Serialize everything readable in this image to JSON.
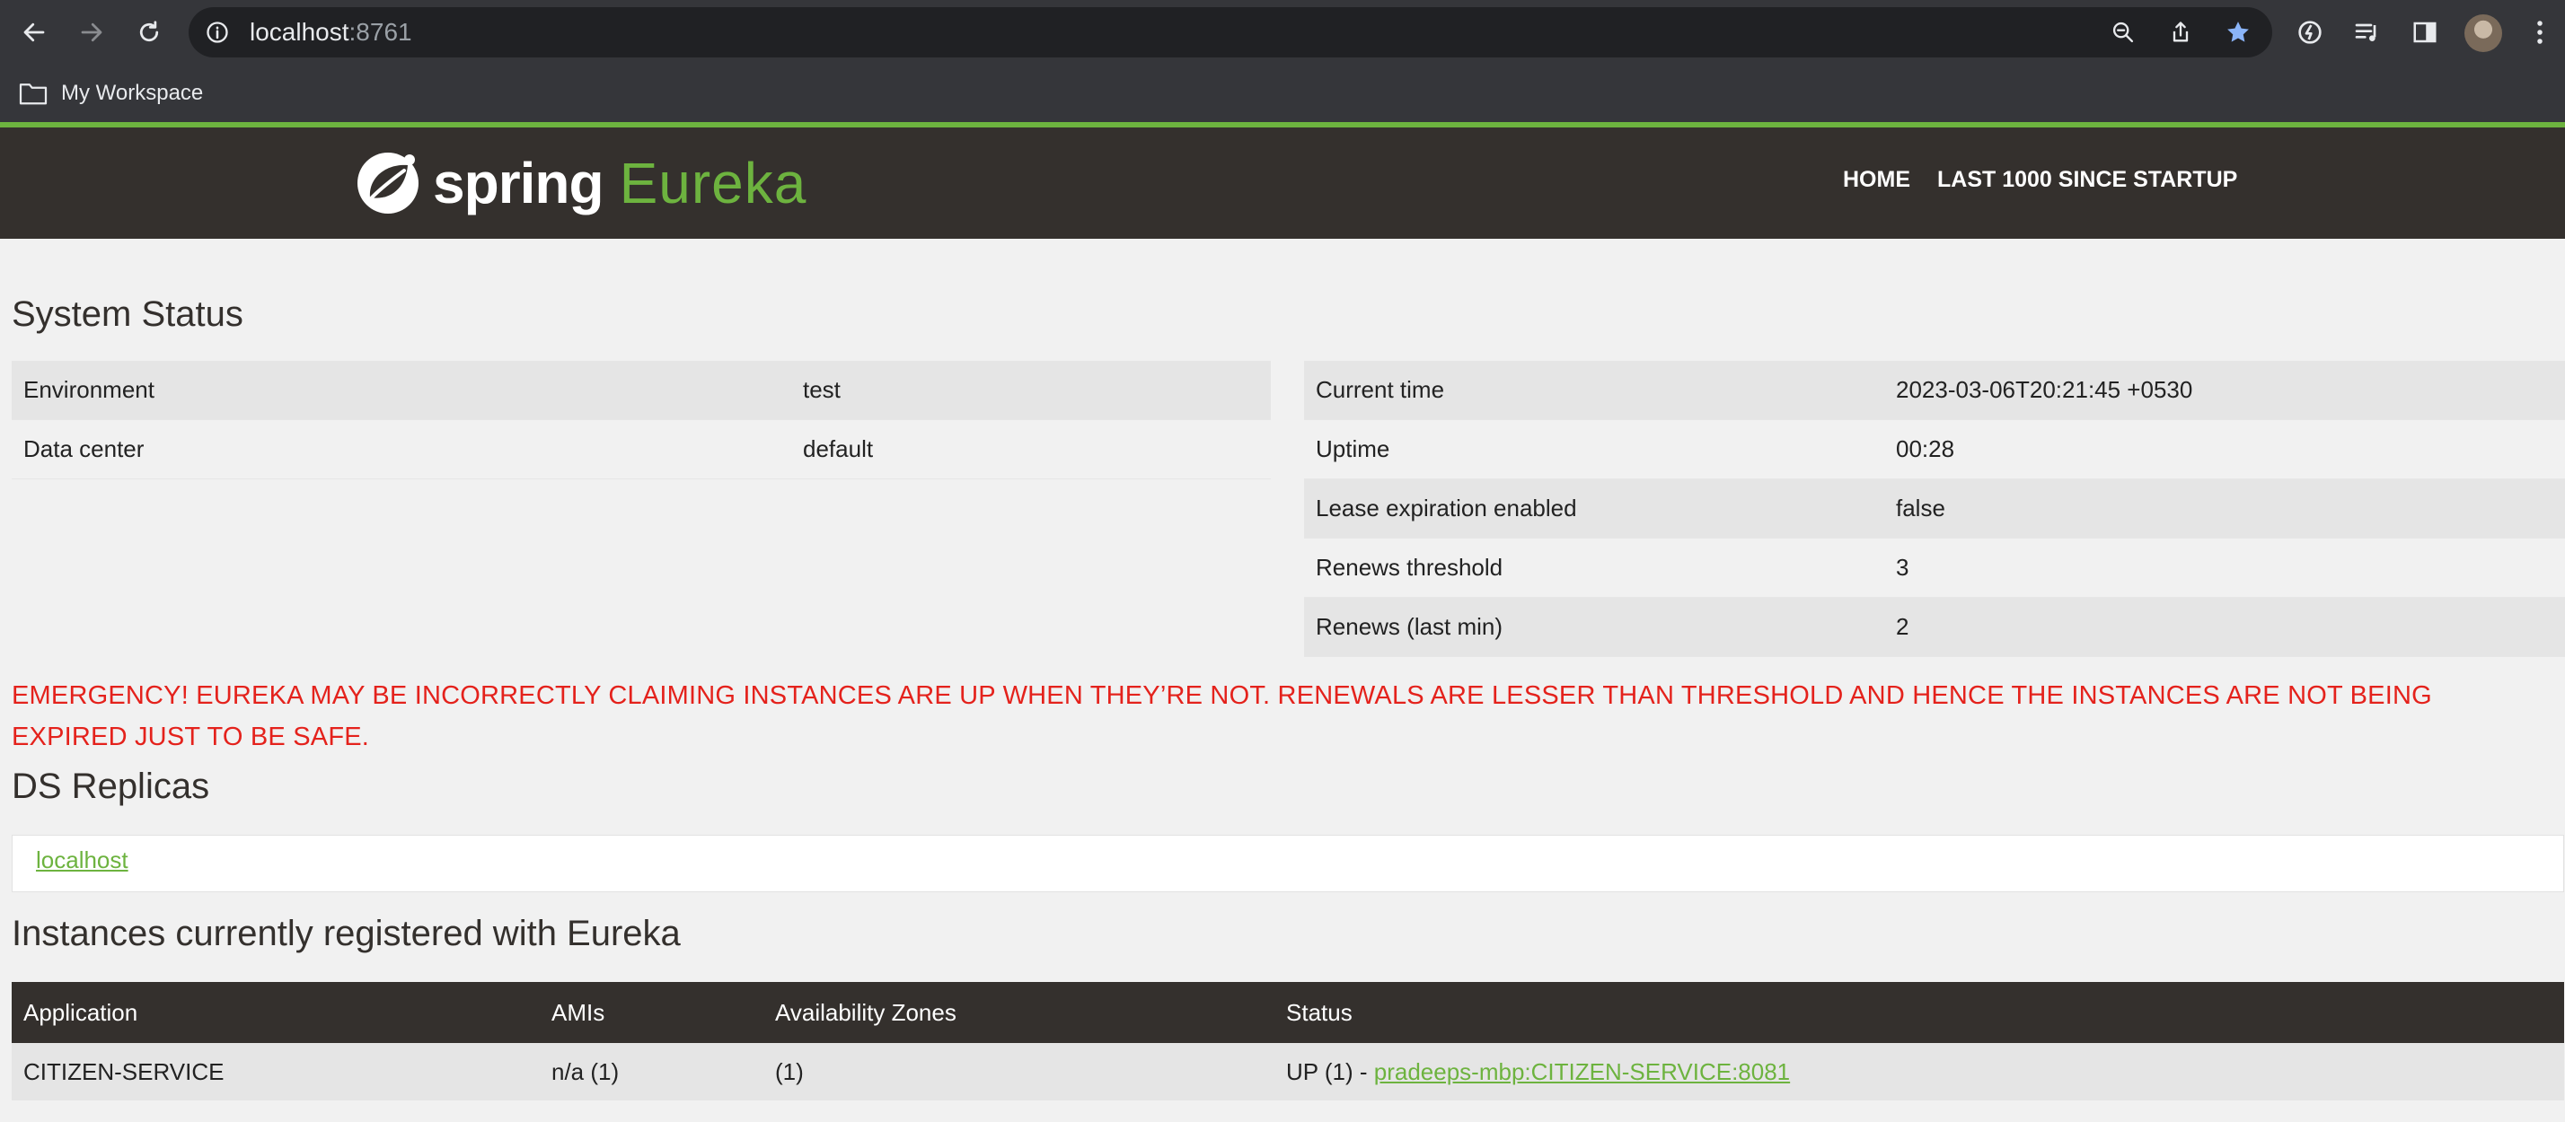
{
  "browser": {
    "url_host": "localhost",
    "url_port": ":8761",
    "bookmark": "My Workspace"
  },
  "header": {
    "brand_spring": "spring",
    "brand_eureka": "Eureka",
    "nav": [
      "HOME",
      "LAST 1000 SINCE STARTUP"
    ]
  },
  "system_status": {
    "title": "System Status",
    "left": [
      {
        "label": "Environment",
        "value": "test"
      },
      {
        "label": "Data center",
        "value": "default"
      }
    ],
    "right": [
      {
        "label": "Current time",
        "value": "2023-03-06T20:21:45 +0530"
      },
      {
        "label": "Uptime",
        "value": "00:28"
      },
      {
        "label": "Lease expiration enabled",
        "value": "false"
      },
      {
        "label": "Renews threshold",
        "value": "3"
      },
      {
        "label": "Renews (last min)",
        "value": "2"
      }
    ]
  },
  "emergency": "EMERGENCY! EUREKA MAY BE INCORRECTLY CLAIMING INSTANCES ARE UP WHEN THEY’RE NOT. RENEWALS ARE LESSER THAN THRESHOLD AND HENCE THE INSTANCES ARE NOT BEING EXPIRED JUST TO BE SAFE.",
  "ds_replicas": {
    "title": "DS Replicas",
    "items": [
      "localhost"
    ]
  },
  "instances": {
    "title": "Instances currently registered with Eureka",
    "columns": [
      "Application",
      "AMIs",
      "Availability Zones",
      "Status"
    ],
    "rows": [
      {
        "application": "CITIZEN-SERVICE",
        "amis": "n/a (1)",
        "zones": "(1)",
        "status_prefix": "UP (1) - ",
        "status_link": "pradeeps-mbp:CITIZEN-SERVICE:8081"
      }
    ]
  },
  "colors": {
    "spring_green": "#6db33f",
    "header_dark": "#34302d",
    "emergency_red": "#e4221c"
  }
}
